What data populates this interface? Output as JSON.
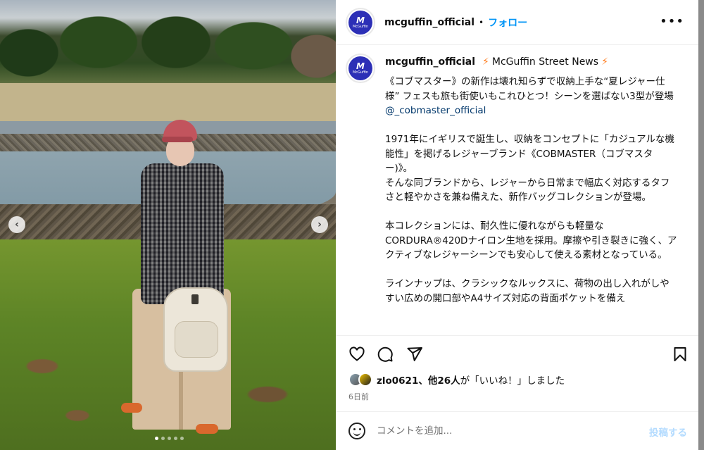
{
  "post": {
    "username": "mcguffin_official",
    "follow_label": "フォロー",
    "separator": "•",
    "more_label": "•••",
    "avatar_mark": "M",
    "avatar_text": "McGuffin",
    "caption_username": "mcguffin_official",
    "caption_subtitle": "McGuffin Street News",
    "caption_text": "《コブマスター》の新作は壊れ知らずで収納上手な“夏レジャー仕様” フェスも旅も街使いもこれひとつ！シーンを選ばない3型が登場",
    "mention": "@_cobmaster_official",
    "caption_paragraph_2": "1971年にイギリスで誕生し、収納をコンセプトに「カジュアルな機能性」を掲げるレジャーブランド《COBMASTER（コブマスター)》。\nそんな同ブランドから、レジャーから日常まで幅広く対応するタフさと軽やかさを兼ね備えた、新作バッグコレクションが登場。",
    "caption_paragraph_3": "本コレクションには、耐久性に優れながらも軽量なCORDURA®420Dナイロン生地を採用。摩擦や引き裂きに強く、アクティブなレジャーシーンでも安心して使える素材となっている。",
    "caption_paragraph_4": "ラインナップは、クラシックなルックスに、荷物の出し入れがしやすい広めの開口部やA4サイズ対応の背面ポケットを備え",
    "likes_user": "zlo0621",
    "likes_others": "、他26人",
    "likes_suffix": "が「いいね！」しました",
    "time": "6日前",
    "comment_placeholder": "コメントを追加...",
    "post_label": "投稿する"
  },
  "icons": {
    "like": "heart-icon",
    "comment": "comment-icon",
    "share": "share-icon",
    "save": "bookmark-icon",
    "emoji": "emoji-icon",
    "prev": "chevron-left-icon",
    "next": "chevron-right-icon",
    "bolt": "lightning-icon"
  },
  "carousel": {
    "current": 1,
    "total": 5
  },
  "colors": {
    "follow": "#0095f6",
    "brand": "#2c2fb6",
    "mention": "#00376b",
    "post_disabled": "#b3dbff"
  }
}
